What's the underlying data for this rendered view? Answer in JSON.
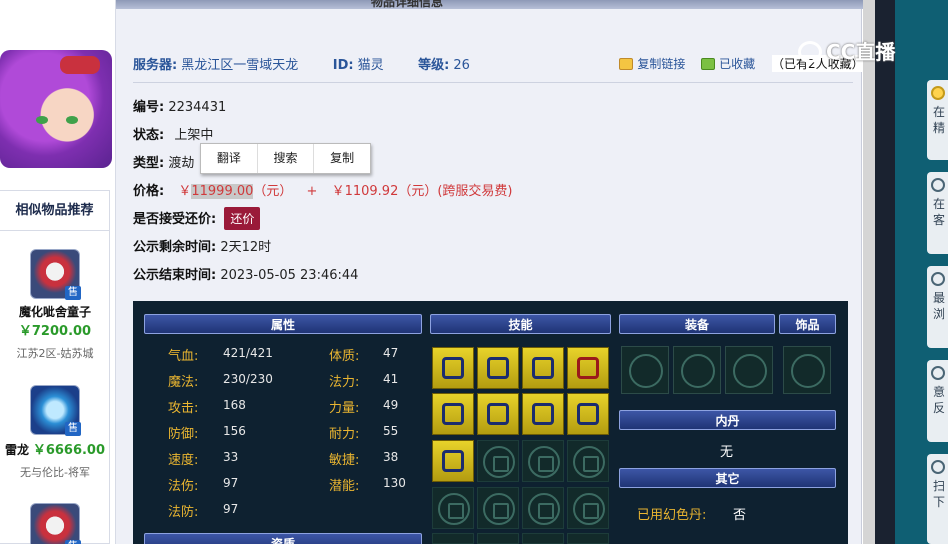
{
  "page": {
    "top_title": "物品详细信息"
  },
  "avatar": {
    "alt": "猫灵"
  },
  "similar": {
    "title": "相似物品推荐",
    "badge": "售",
    "items": [
      {
        "name": "魔化呲舍童子",
        "price": "￥7200.00",
        "server": "江苏2区-姑苏城"
      },
      {
        "name": "雷龙",
        "price": "￥6666.00",
        "server": "无与伦比-将军"
      }
    ]
  },
  "header": {
    "server_label": "服务器:",
    "server_value": "黑龙江区一雪域天龙",
    "id_label": "ID:",
    "id_value": "猫灵",
    "level_label": "等级:",
    "level_value": "26",
    "copy_link": "复制链接",
    "favorited": "已收藏",
    "collect_note": "（已有2人收藏）"
  },
  "details": {
    "number_label": "编号:",
    "number_value": "2234431",
    "status_label": "状态:",
    "status_value": "上架中",
    "type_label": "类型:",
    "type_value": "渡劫",
    "price_label": "价格:",
    "price_yen": "￥",
    "price_amount": "11999.00",
    "price_unit": "（元）",
    "plus": "+",
    "fee": "￥1109.92（元）(跨服交易费)",
    "bargain_label": "是否接受还价:",
    "bargain_button": "还价",
    "remain_label": "公示剩余时间:",
    "remain_value": "2天12时",
    "end_label": "公示结束时间:",
    "end_value": "2023-05-05 23:46:44"
  },
  "context_menu": {
    "translate": "翻译",
    "search": "搜索",
    "copy": "复制"
  },
  "panel": {
    "attr_title": "属性",
    "skill_title": "技能",
    "equip_title": "装备",
    "accessory_title": "饰品",
    "inner_title": "内丹",
    "inner_value": "无",
    "other_title": "其它",
    "other_label": "已用幻色丹:",
    "other_value": "否",
    "bottom_title": "资质",
    "attrs_left": [
      {
        "k": "气血:",
        "v": "421/421"
      },
      {
        "k": "魔法:",
        "v": "230/230"
      },
      {
        "k": "攻击:",
        "v": "168"
      },
      {
        "k": "防御:",
        "v": "156"
      },
      {
        "k": "速度:",
        "v": "33"
      },
      {
        "k": "法伤:",
        "v": "97"
      },
      {
        "k": "法防:",
        "v": "97"
      }
    ],
    "attrs_right": [
      {
        "k": "体质:",
        "v": "47"
      },
      {
        "k": "法力:",
        "v": "41"
      },
      {
        "k": "力量:",
        "v": "49"
      },
      {
        "k": "耐力:",
        "v": "55"
      },
      {
        "k": "敏捷:",
        "v": "38"
      },
      {
        "k": "潜能:",
        "v": "130"
      }
    ]
  },
  "watermark": {
    "text": "CC直播"
  },
  "right_bar": {
    "items": [
      "在",
      "精",
      "在",
      "客",
      "最",
      "浏",
      "意",
      "反",
      "扫",
      "下"
    ]
  },
  "colors": {
    "price_red": "#d0393b",
    "attr_gold": "#e9b531",
    "panel_bg": "#0e2130",
    "link_blue": "#2a5599",
    "bargain": "#9a1a39"
  }
}
